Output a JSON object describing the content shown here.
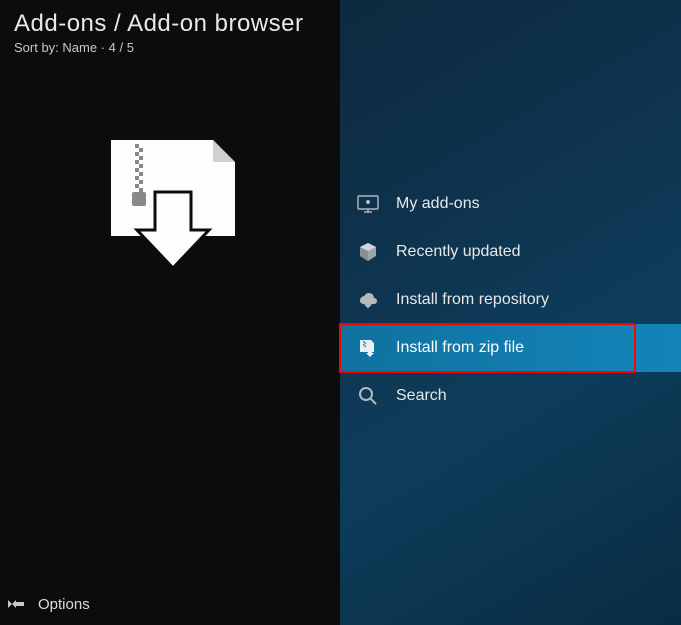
{
  "header": {
    "breadcrumb": "Add-ons / Add-on browser",
    "sort_prefix": "Sort by: ",
    "sort_value": "Name",
    "count_separator": "  ·  ",
    "count": "4 / 5"
  },
  "menu": {
    "items": [
      {
        "label": "My add-ons"
      },
      {
        "label": "Recently updated"
      },
      {
        "label": "Install from repository"
      },
      {
        "label": "Install from zip file"
      },
      {
        "label": "Search"
      }
    ]
  },
  "footer": {
    "options_label": "Options"
  }
}
